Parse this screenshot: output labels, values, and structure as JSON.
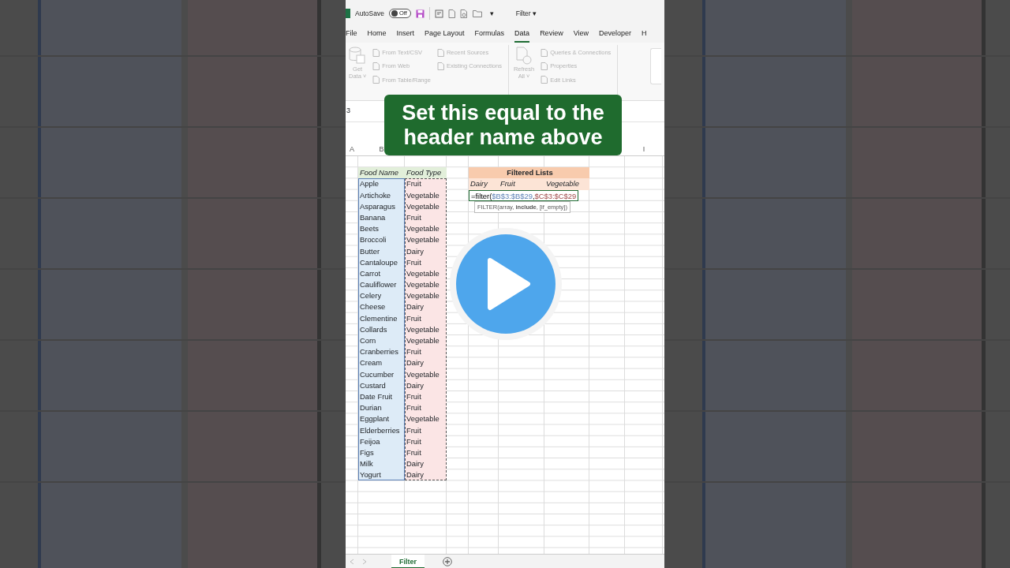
{
  "title_bar": {
    "autosave": {
      "label": "AutoSave",
      "on": false,
      "state": "Off"
    },
    "document": "Filter",
    "document_caret": "▾",
    "quick_access_caret": "▾"
  },
  "ribbon_tabs": [
    {
      "label": "File",
      "selected": false
    },
    {
      "label": "Home",
      "selected": false
    },
    {
      "label": "Insert",
      "selected": false
    },
    {
      "label": "Page Layout",
      "selected": false
    },
    {
      "label": "Formulas",
      "selected": false
    },
    {
      "label": "Data",
      "selected": true
    },
    {
      "label": "Review",
      "selected": false
    },
    {
      "label": "View",
      "selected": false
    },
    {
      "label": "Developer",
      "selected": false
    },
    {
      "label": "H",
      "selected": false
    }
  ],
  "ribbon": {
    "groups": [
      {
        "large": {
          "lines": [
            "Get",
            "Data ˅"
          ],
          "disabled": true
        },
        "columns": [
          [
            {
              "label": "From Text/CSV",
              "disabled": true
            },
            {
              "label": "From Web",
              "disabled": true
            },
            {
              "label": "From Table/Range",
              "disabled": true
            }
          ],
          [
            {
              "label": "Recent Sources",
              "disabled": true
            },
            {
              "label": "Existing Connections",
              "disabled": true
            }
          ]
        ]
      },
      {
        "large": {
          "lines": [
            "Refresh",
            "All ˅"
          ],
          "disabled": true
        },
        "columns": [
          [
            {
              "label": "Queries & Connections",
              "disabled": true
            },
            {
              "label": "Properties",
              "disabled": true
            },
            {
              "label": "Edit Links",
              "disabled": true
            }
          ]
        ]
      }
    ]
  },
  "name_box": "3",
  "column_headers": {
    "left": [
      "A",
      "B"
    ],
    "right": [
      "I"
    ]
  },
  "table": {
    "header": [
      "Food Name",
      "Food Type"
    ],
    "rows": [
      {
        "name": "Apple",
        "type": "Fruit"
      },
      {
        "name": "Artichoke",
        "type": "Vegetable"
      },
      {
        "name": "Asparagus",
        "type": "Vegetable"
      },
      {
        "name": "Banana",
        "type": "Fruit"
      },
      {
        "name": "Beets",
        "type": "Vegetable"
      },
      {
        "name": "Broccoli",
        "type": "Vegetable"
      },
      {
        "name": "Butter",
        "type": "Dairy"
      },
      {
        "name": "Cantaloupe",
        "type": "Fruit"
      },
      {
        "name": "Carrot",
        "type": "Vegetable"
      },
      {
        "name": "Cauliflower",
        "type": "Vegetable"
      },
      {
        "name": "Celery",
        "type": "Vegetable"
      },
      {
        "name": "Cheese",
        "type": "Dairy"
      },
      {
        "name": "Clementine",
        "type": "Fruit"
      },
      {
        "name": "Collards",
        "type": "Vegetable"
      },
      {
        "name": "Corn",
        "type": "Vegetable"
      },
      {
        "name": "Cranberries",
        "type": "Fruit"
      },
      {
        "name": "Cream",
        "type": "Dairy"
      },
      {
        "name": "Cucumber",
        "type": "Vegetable"
      },
      {
        "name": "Custard",
        "type": "Dairy"
      },
      {
        "name": "Date Fruit",
        "type": "Fruit"
      },
      {
        "name": "Durian",
        "type": "Fruit"
      },
      {
        "name": "Eggplant",
        "type": "Vegetable"
      },
      {
        "name": "Elderberries",
        "type": "Fruit"
      },
      {
        "name": "Feijoa",
        "type": "Fruit"
      },
      {
        "name": "Figs",
        "type": "Fruit"
      },
      {
        "name": "Milk",
        "type": "Dairy"
      },
      {
        "name": "Yogurt",
        "type": "Dairy"
      }
    ]
  },
  "filtered_lists": {
    "title": "Filtered Lists",
    "categories": [
      "Dairy",
      "Fruit",
      "Vegetable"
    ],
    "formula": [
      {
        "text": "=filter(",
        "kind": "text"
      },
      {
        "text": "$B$3:$B$29",
        "kind": "reference"
      },
      {
        "text": ",",
        "kind": "text"
      },
      {
        "text": "$C$3:$C$29",
        "kind": "reference"
      }
    ],
    "tooltip": "FILTER(array, **include**, [if_empty])"
  },
  "caption": [
    "Set this equal to the",
    "header name above"
  ],
  "sheet_tabs": [
    {
      "label": "Filter",
      "selected": true
    }
  ]
}
